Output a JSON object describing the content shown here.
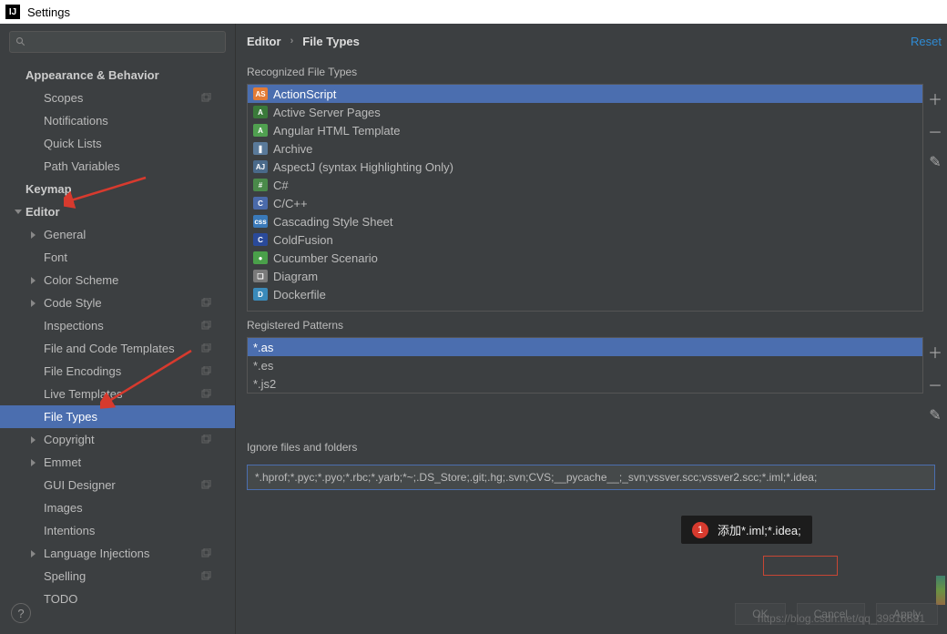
{
  "window": {
    "title": "Settings"
  },
  "search": {
    "placeholder": ""
  },
  "crumbs": {
    "a": "Editor",
    "b": "File Types",
    "reset": "Reset"
  },
  "tree": [
    {
      "lvl": 1,
      "label": "Appearance & Behavior",
      "arrow": null,
      "copy": false
    },
    {
      "lvl": 2,
      "label": "Scopes",
      "copy": true
    },
    {
      "lvl": 2,
      "label": "Notifications"
    },
    {
      "lvl": 2,
      "label": "Quick Lists"
    },
    {
      "lvl": 2,
      "label": "Path Variables"
    },
    {
      "lvl": 1,
      "label": "Keymap"
    },
    {
      "lvl": 1,
      "label": "Editor",
      "arrow": "down"
    },
    {
      "lvl": 2,
      "label": "General",
      "arrow": "right"
    },
    {
      "lvl": 2,
      "label": "Font"
    },
    {
      "lvl": 2,
      "label": "Color Scheme",
      "arrow": "right"
    },
    {
      "lvl": 2,
      "label": "Code Style",
      "arrow": "right",
      "copy": true
    },
    {
      "lvl": 2,
      "label": "Inspections",
      "copy": true
    },
    {
      "lvl": 2,
      "label": "File and Code Templates",
      "copy": true
    },
    {
      "lvl": 2,
      "label": "File Encodings",
      "copy": true
    },
    {
      "lvl": 2,
      "label": "Live Templates",
      "copy": true
    },
    {
      "lvl": 2,
      "label": "File Types",
      "sel": true
    },
    {
      "lvl": 2,
      "label": "Copyright",
      "arrow": "right",
      "copy": true
    },
    {
      "lvl": 2,
      "label": "Emmet",
      "arrow": "right"
    },
    {
      "lvl": 2,
      "label": "GUI Designer",
      "copy": true
    },
    {
      "lvl": 2,
      "label": "Images"
    },
    {
      "lvl": 2,
      "label": "Intentions"
    },
    {
      "lvl": 2,
      "label": "Language Injections",
      "arrow": "right",
      "copy": true
    },
    {
      "lvl": 2,
      "label": "Spelling",
      "copy": true
    },
    {
      "lvl": 2,
      "label": "TODO"
    }
  ],
  "labels": {
    "recognized": "Recognized File Types",
    "patterns": "Registered Patterns",
    "ignore": "Ignore files and folders"
  },
  "types": [
    {
      "label": "ActionScript",
      "sel": true,
      "c": "#e27b35",
      "t": "AS"
    },
    {
      "label": "Active Server Pages",
      "c": "#3a7a3a",
      "t": "A"
    },
    {
      "label": "Angular HTML Template",
      "c": "#50a050",
      "t": "A"
    },
    {
      "label": "Archive",
      "c": "#5a7a9a",
      "t": "❚"
    },
    {
      "label": "AspectJ (syntax Highlighting Only)",
      "c": "#4a6a8a",
      "t": "AJ"
    },
    {
      "label": "C#",
      "c": "#4a8a4a",
      "t": "#"
    },
    {
      "label": "C/C++",
      "c": "#4a6aaa",
      "t": "C"
    },
    {
      "label": "Cascading Style Sheet",
      "c": "#3a7aba",
      "t": "css"
    },
    {
      "label": "ColdFusion",
      "c": "#2a4a9a",
      "t": "C"
    },
    {
      "label": "Cucumber Scenario",
      "c": "#4aa04a",
      "t": "●"
    },
    {
      "label": "Diagram",
      "c": "#7a7a7a",
      "t": "❏"
    },
    {
      "label": "Dockerfile",
      "c": "#3a8aba",
      "t": "D"
    }
  ],
  "patterns": [
    {
      "label": "*.as",
      "sel": true
    },
    {
      "label": "*.es"
    },
    {
      "label": "*.js2"
    }
  ],
  "ignore": {
    "value": "*.hprof;*.pyc;*.pyo;*.rbc;*.yarb;*~;.DS_Store;.git;.hg;.svn;CVS;__pycache__;_svn;vssver.scc;vssver2.scc;*.iml;*.idea;"
  },
  "callout": {
    "num": "1",
    "text": "添加*.iml;*.idea;"
  },
  "footer": {
    "ok": "OK",
    "cancel": "Cancel",
    "apply": "Apply"
  },
  "watermark": "https://blog.csdn.net/qq_39816581"
}
